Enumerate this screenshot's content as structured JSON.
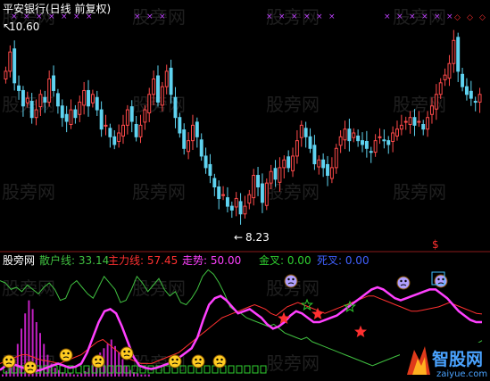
{
  "watermark": "股旁网",
  "brand": {
    "name": "智股网",
    "url": "zaiyue.com"
  },
  "colors": {
    "up": "#ff4a4a",
    "down": "#5fd3f0",
    "retail": "#40c040",
    "main": "#ff3030",
    "trend": "#ff40ff",
    "gold": "#30d030",
    "dead": "#4060ff",
    "cross": "#c040ff",
    "bg": "#000000"
  },
  "chart_data": [
    {
      "type": "candlestick",
      "title": "平安银行(日线 前复权)",
      "annotations": [
        {
          "text": "10.60",
          "kind": "max"
        },
        {
          "text": "8.23",
          "kind": "min"
        }
      ],
      "ylim": [
        8.0,
        10.8
      ],
      "closes": [
        10.2,
        10.45,
        10.05,
        9.95,
        9.75,
        9.85,
        9.6,
        9.7,
        9.9,
        9.8,
        10.1,
        9.95,
        9.75,
        9.6,
        9.55,
        9.7,
        9.6,
        9.8,
        9.95,
        9.75,
        9.9,
        9.7,
        9.45,
        9.5,
        9.35,
        9.25,
        9.4,
        9.5,
        9.7,
        9.55,
        9.35,
        9.5,
        9.7,
        9.9,
        10.1,
        9.8,
        10.0,
        10.2,
        9.9,
        9.6,
        9.4,
        9.2,
        9.3,
        9.5,
        9.35,
        9.1,
        8.95,
        8.85,
        8.7,
        8.55,
        8.6,
        8.45,
        8.4,
        8.55,
        8.35,
        8.45,
        8.6,
        8.85,
        8.7,
        8.5,
        8.75,
        8.9,
        8.8,
        8.95,
        9.05,
        8.95,
        9.1,
        9.3,
        9.5,
        9.35,
        9.2,
        9.0,
        9.05,
        8.95,
        8.85,
        8.95,
        9.2,
        9.35,
        9.45,
        9.3,
        9.4,
        9.3,
        9.25,
        9.2,
        9.15,
        9.3,
        9.35,
        9.3,
        9.25,
        9.4,
        9.45,
        9.5,
        9.55,
        9.6,
        9.5,
        9.55,
        9.45,
        9.6,
        9.75,
        9.9,
        10.05,
        10.15,
        10.3,
        10.6,
        10.2,
        10.0,
        9.9,
        9.85,
        9.8,
        9.9
      ]
    },
    {
      "type": "line",
      "title": "股旁网",
      "ylim": [
        0,
        100
      ],
      "series": [
        {
          "name": "散户线",
          "label": "散户线: 33.14",
          "color": "#40c040",
          "values": [
            88,
            86,
            80,
            82,
            78,
            84,
            80,
            76,
            82,
            86,
            80,
            70,
            72,
            84,
            88,
            82,
            76,
            72,
            82,
            92,
            86,
            80,
            68,
            70,
            80,
            92,
            86,
            78,
            84,
            90,
            80,
            74,
            78,
            68,
            66,
            72,
            80,
            92,
            98,
            94,
            86,
            76,
            64,
            60,
            58,
            54,
            52,
            50,
            48,
            46,
            48,
            44,
            40,
            38,
            36,
            34,
            36,
            32,
            30,
            28,
            26,
            24,
            22,
            20,
            18,
            16,
            14,
            12,
            10,
            12,
            14,
            16,
            18,
            20,
            22,
            20,
            18,
            16,
            14,
            12,
            10,
            14,
            18,
            22,
            24,
            26,
            28,
            30,
            33
          ]
        },
        {
          "name": "主力线",
          "label": "主力线: 57.45",
          "color": "#ff3030",
          "values": [
            12,
            14,
            16,
            18,
            20,
            20,
            18,
            16,
            15,
            14,
            13,
            12,
            14,
            16,
            18,
            20,
            24,
            28,
            32,
            34,
            30,
            26,
            22,
            18,
            16,
            14,
            12,
            12,
            12,
            14,
            16,
            18,
            20,
            22,
            26,
            30,
            34,
            38,
            42,
            46,
            50,
            54,
            56,
            58,
            60,
            62,
            64,
            66,
            64,
            62,
            58,
            56,
            60,
            64,
            66,
            68,
            66,
            64,
            62,
            60,
            58,
            60,
            62,
            64,
            66,
            68,
            70,
            72,
            74,
            74,
            72,
            70,
            68,
            66,
            64,
            62,
            60,
            60,
            61,
            62,
            63,
            64,
            66,
            68,
            66,
            64,
            62,
            60,
            58,
            57.45
          ]
        },
        {
          "name": "走势",
          "label": "走势: 50.00",
          "color": "#ff40ff",
          "values": [
            6,
            10,
            12,
            10,
            8,
            6,
            5,
            6,
            8,
            10,
            12,
            10,
            8,
            9,
            12,
            22,
            36,
            50,
            60,
            62,
            58,
            46,
            32,
            18,
            10,
            8,
            7,
            8,
            10,
            12,
            14,
            18,
            22,
            26,
            36,
            52,
            66,
            72,
            74,
            70,
            64,
            58,
            60,
            62,
            58,
            54,
            48,
            44,
            46,
            50,
            56,
            60,
            58,
            54,
            50,
            50,
            52,
            54,
            56,
            60,
            64,
            68,
            72,
            76,
            80,
            82,
            80,
            76,
            72,
            70,
            72,
            74,
            76,
            78,
            80,
            80,
            76,
            72,
            66,
            60,
            56,
            52,
            50,
            50
          ]
        }
      ],
      "signals": [
        {
          "label": "金叉: 0.00",
          "value": "0.00"
        },
        {
          "label": "死叉: 0.00",
          "value": "0.00"
        }
      ],
      "histogram": [
        2,
        5,
        10,
        18,
        30,
        44,
        58,
        70,
        62,
        50,
        40,
        30,
        20,
        12,
        8,
        6,
        4,
        3,
        3,
        2,
        2,
        3,
        5,
        8,
        12,
        18,
        22,
        26,
        30,
        34,
        28,
        22,
        16,
        10,
        6,
        4,
        3,
        2,
        2,
        2
      ]
    }
  ]
}
